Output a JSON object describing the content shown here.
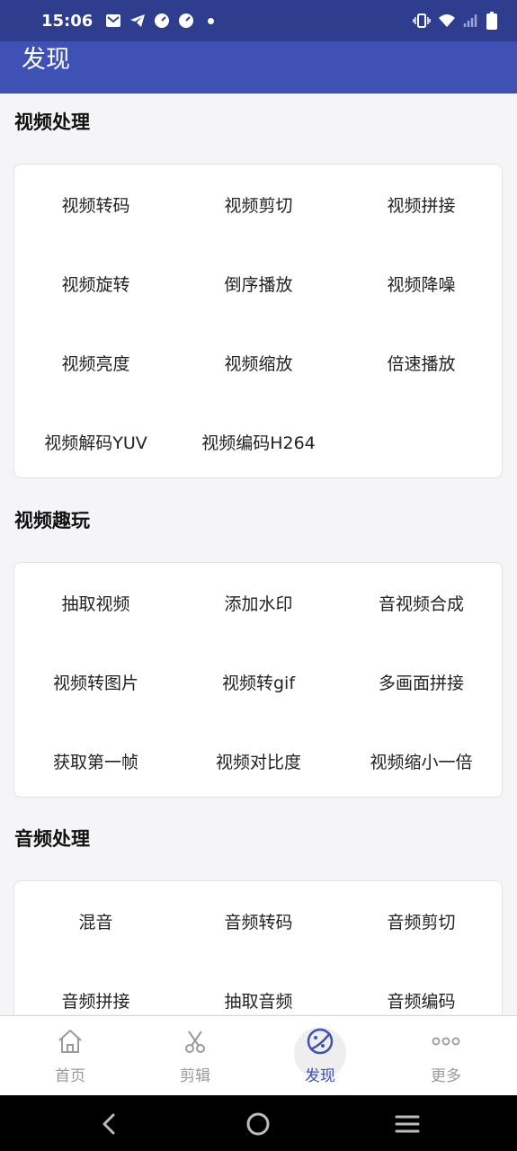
{
  "status_bar": {
    "time": "15:06",
    "left_icons": [
      "mail-icon",
      "telegram-icon",
      "speedometer-icon",
      "speedometer-icon",
      "dot-icon"
    ],
    "right_icons": [
      "vibrate-icon",
      "wifi-icon",
      "signal-icon",
      "battery-icon"
    ]
  },
  "app_bar": {
    "title": "发现"
  },
  "sections": [
    {
      "title": "视频处理",
      "items": [
        "视频转码",
        "视频剪切",
        "视频拼接",
        "视频旋转",
        "倒序播放",
        "视频降噪",
        "视频亮度",
        "视频缩放",
        "倍速播放",
        "视频解码YUV",
        "视频编码H264"
      ]
    },
    {
      "title": "视频趣玩",
      "items": [
        "抽取视频",
        "添加水印",
        "音视频合成",
        "视频转图片",
        "视频转gif",
        "多画面拼接",
        "获取第一帧",
        "视频对比度",
        "视频缩小一倍"
      ]
    },
    {
      "title": "音频处理",
      "items": [
        "混音",
        "音频转码",
        "音频剪切",
        "音频拼接",
        "抽取音频",
        "音频编码"
      ]
    }
  ],
  "bottom_nav": {
    "items": [
      {
        "label": "首页",
        "icon": "home-icon"
      },
      {
        "label": "剪辑",
        "icon": "scissors-icon"
      },
      {
        "label": "发现",
        "icon": "discover-icon"
      },
      {
        "label": "更多",
        "icon": "more-icon"
      }
    ],
    "active": "发现"
  },
  "colors": {
    "status_bar": "#2f3d8f",
    "app_bar": "#3f51b5",
    "accent": "#3f51b5",
    "inactive": "#9a9a9a"
  }
}
